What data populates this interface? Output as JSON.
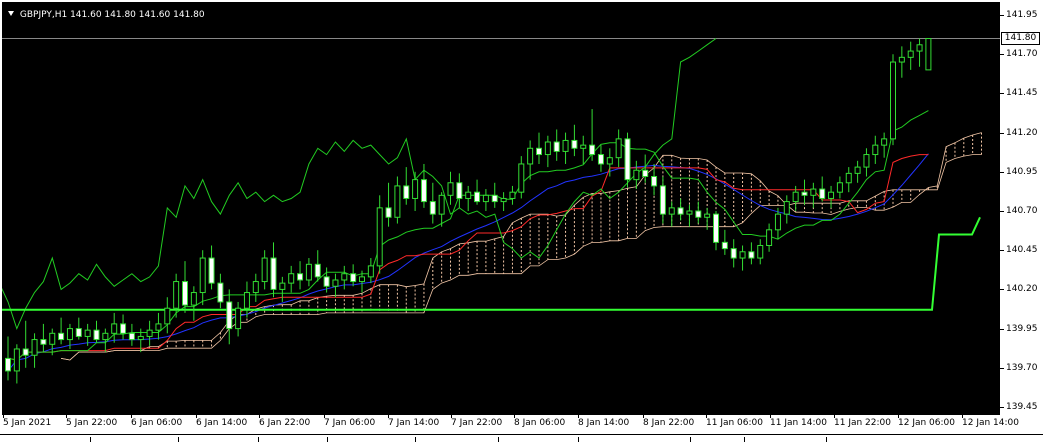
{
  "chart_header": {
    "symbol": "GBPJPY,H1",
    "ohlc": "141.60 141.80 141.60 141.80"
  },
  "current_price": "141.80",
  "price_axis": {
    "labels": [
      "141.95",
      "141.70",
      "141.45",
      "141.20",
      "140.95",
      "140.70",
      "140.45",
      "140.20",
      "139.95",
      "139.70",
      "139.45"
    ]
  },
  "time_axis": {
    "labels": [
      "5 Jan 2021",
      "5 Jan 22:00",
      "6 Jan 06:00",
      "6 Jan 14:00",
      "6 Jan 22:00",
      "7 Jan 06:00",
      "7 Jan 14:00",
      "7 Jan 22:00",
      "8 Jan 06:00",
      "8 Jan 14:00",
      "8 Jan 22:00",
      "11 Jan 06:00",
      "11 Jan 14:00",
      "11 Jan 22:00",
      "12 Jan 06:00",
      "12 Jan 14:00"
    ]
  },
  "colors": {
    "background": "#000000",
    "candles": "#33dd33",
    "chikou_span": "#22cc22",
    "tenkan_kijun": "#ff2a2a",
    "moving_average": "#2233ff",
    "kumo_cloud": "#f2c6a6",
    "support_line": "#33ff33"
  },
  "chart_data": {
    "type": "candlestick",
    "title": "GBPJPY,H1",
    "ylim": [
      139.45,
      141.95
    ],
    "candles": [
      [
        139.76,
        139.9,
        139.62,
        139.68
      ],
      [
        139.68,
        139.85,
        139.6,
        139.82
      ],
      [
        139.82,
        140.0,
        139.7,
        139.78
      ],
      [
        139.78,
        139.92,
        139.7,
        139.88
      ],
      [
        139.88,
        139.98,
        139.8,
        139.85
      ],
      [
        139.85,
        139.95,
        139.78,
        139.92
      ],
      [
        139.92,
        140.02,
        139.85,
        139.88
      ],
      [
        139.88,
        139.98,
        139.82,
        139.95
      ],
      [
        139.95,
        140.02,
        139.88,
        139.9
      ],
      [
        139.9,
        139.98,
        139.84,
        139.94
      ],
      [
        139.94,
        140.0,
        139.86,
        139.88
      ],
      [
        139.88,
        139.95,
        139.8,
        139.92
      ],
      [
        139.92,
        140.05,
        139.86,
        139.98
      ],
      [
        139.98,
        140.04,
        139.88,
        139.92
      ],
      [
        139.92,
        139.98,
        139.84,
        139.88
      ],
      [
        139.88,
        139.95,
        139.8,
        139.9
      ],
      [
        139.9,
        140.0,
        139.84,
        139.94
      ],
      [
        139.94,
        140.05,
        139.88,
        139.98
      ],
      [
        139.98,
        140.15,
        139.92,
        140.08
      ],
      [
        140.08,
        140.3,
        140.02,
        140.25
      ],
      [
        140.25,
        140.38,
        140.05,
        140.1
      ],
      [
        140.1,
        140.22,
        140.0,
        140.18
      ],
      [
        140.18,
        140.45,
        140.1,
        140.4
      ],
      [
        140.4,
        140.48,
        140.2,
        140.24
      ],
      [
        140.24,
        140.3,
        140.08,
        140.12
      ],
      [
        140.12,
        140.2,
        139.85,
        139.95
      ],
      [
        139.95,
        140.12,
        139.9,
        140.08
      ],
      [
        140.08,
        140.25,
        140.02,
        140.18
      ],
      [
        140.18,
        140.3,
        140.12,
        140.25
      ],
      [
        140.25,
        140.45,
        140.2,
        140.4
      ],
      [
        140.4,
        140.5,
        140.15,
        140.2
      ],
      [
        140.2,
        140.28,
        140.12,
        140.24
      ],
      [
        140.24,
        140.35,
        140.18,
        140.3
      ],
      [
        140.3,
        140.38,
        140.2,
        140.26
      ],
      [
        140.26,
        140.4,
        140.22,
        140.36
      ],
      [
        140.36,
        140.45,
        140.25,
        140.28
      ],
      [
        140.28,
        140.34,
        140.18,
        140.22
      ],
      [
        140.22,
        140.3,
        140.15,
        140.26
      ],
      [
        140.26,
        140.35,
        140.2,
        140.3
      ],
      [
        140.3,
        140.36,
        140.22,
        140.25
      ],
      [
        140.25,
        140.32,
        140.18,
        140.28
      ],
      [
        140.28,
        140.4,
        140.24,
        140.35
      ],
      [
        140.35,
        140.8,
        140.3,
        140.72
      ],
      [
        140.72,
        140.88,
        140.6,
        140.66
      ],
      [
        140.66,
        140.92,
        140.62,
        140.86
      ],
      [
        140.86,
        140.98,
        140.74,
        140.78
      ],
      [
        140.78,
        140.95,
        140.7,
        140.9
      ],
      [
        140.9,
        141.0,
        140.72,
        140.76
      ],
      [
        140.76,
        140.88,
        140.62,
        140.68
      ],
      [
        140.68,
        140.82,
        140.6,
        140.8
      ],
      [
        140.8,
        140.95,
        140.74,
        140.88
      ],
      [
        140.88,
        140.94,
        140.72,
        140.78
      ],
      [
        140.78,
        140.86,
        140.7,
        140.82
      ],
      [
        140.82,
        140.9,
        140.74,
        140.76
      ],
      [
        140.76,
        140.84,
        140.7,
        140.8
      ],
      [
        140.8,
        140.88,
        140.72,
        140.76
      ],
      [
        140.76,
        140.82,
        140.7,
        140.78
      ],
      [
        140.78,
        140.86,
        140.74,
        140.82
      ],
      [
        140.82,
        141.05,
        140.78,
        141.0
      ],
      [
        141.0,
        141.15,
        140.9,
        141.1
      ],
      [
        141.1,
        141.2,
        141.0,
        141.06
      ],
      [
        141.06,
        141.18,
        140.98,
        141.14
      ],
      [
        141.14,
        141.22,
        141.02,
        141.08
      ],
      [
        141.08,
        141.2,
        141.0,
        141.15
      ],
      [
        141.15,
        141.25,
        141.05,
        141.1
      ],
      [
        141.1,
        141.18,
        141.0,
        141.12
      ],
      [
        141.12,
        141.35,
        141.02,
        141.06
      ],
      [
        141.06,
        141.12,
        140.95,
        141.0
      ],
      [
        141.0,
        141.1,
        140.92,
        141.04
      ],
      [
        141.04,
        141.22,
        140.98,
        141.16
      ],
      [
        141.16,
        141.2,
        140.85,
        140.9
      ],
      [
        140.9,
        141.02,
        140.84,
        140.96
      ],
      [
        140.96,
        141.06,
        140.88,
        140.92
      ],
      [
        140.92,
        141.0,
        140.8,
        140.86
      ],
      [
        140.86,
        140.92,
        140.62,
        140.68
      ],
      [
        140.68,
        140.76,
        140.6,
        140.72
      ],
      [
        140.72,
        140.78,
        140.64,
        140.68
      ],
      [
        140.68,
        140.74,
        140.6,
        140.7
      ],
      [
        140.7,
        140.76,
        140.62,
        140.66
      ],
      [
        140.66,
        140.72,
        140.58,
        140.68
      ],
      [
        140.68,
        140.7,
        140.45,
        140.5
      ],
      [
        140.5,
        140.58,
        140.42,
        140.46
      ],
      [
        140.46,
        140.52,
        140.34,
        140.4
      ],
      [
        140.4,
        140.48,
        140.32,
        140.44
      ],
      [
        140.44,
        140.5,
        140.36,
        140.4
      ],
      [
        140.4,
        140.52,
        140.36,
        140.48
      ],
      [
        140.48,
        140.62,
        140.44,
        140.58
      ],
      [
        140.58,
        140.72,
        140.52,
        140.68
      ],
      [
        140.68,
        140.8,
        140.62,
        140.76
      ],
      [
        140.76,
        140.86,
        140.7,
        140.82
      ],
      [
        140.82,
        140.9,
        140.74,
        140.8
      ],
      [
        140.8,
        140.88,
        140.72,
        140.84
      ],
      [
        140.84,
        140.92,
        140.76,
        140.78
      ],
      [
        140.78,
        140.86,
        140.72,
        140.82
      ],
      [
        140.82,
        140.92,
        140.78,
        140.88
      ],
      [
        140.88,
        140.98,
        140.82,
        140.94
      ],
      [
        140.94,
        141.02,
        140.88,
        140.98
      ],
      [
        140.98,
        141.1,
        140.92,
        141.06
      ],
      [
        141.06,
        141.18,
        141.0,
        141.12
      ],
      [
        141.12,
        141.2,
        141.04,
        141.16
      ],
      [
        141.16,
        141.7,
        141.12,
        141.65
      ],
      [
        141.65,
        141.75,
        141.55,
        141.68
      ],
      [
        141.68,
        141.78,
        141.6,
        141.72
      ],
      [
        141.72,
        141.8,
        141.62,
        141.76
      ],
      [
        141.6,
        141.8,
        141.6,
        141.8
      ]
    ]
  }
}
